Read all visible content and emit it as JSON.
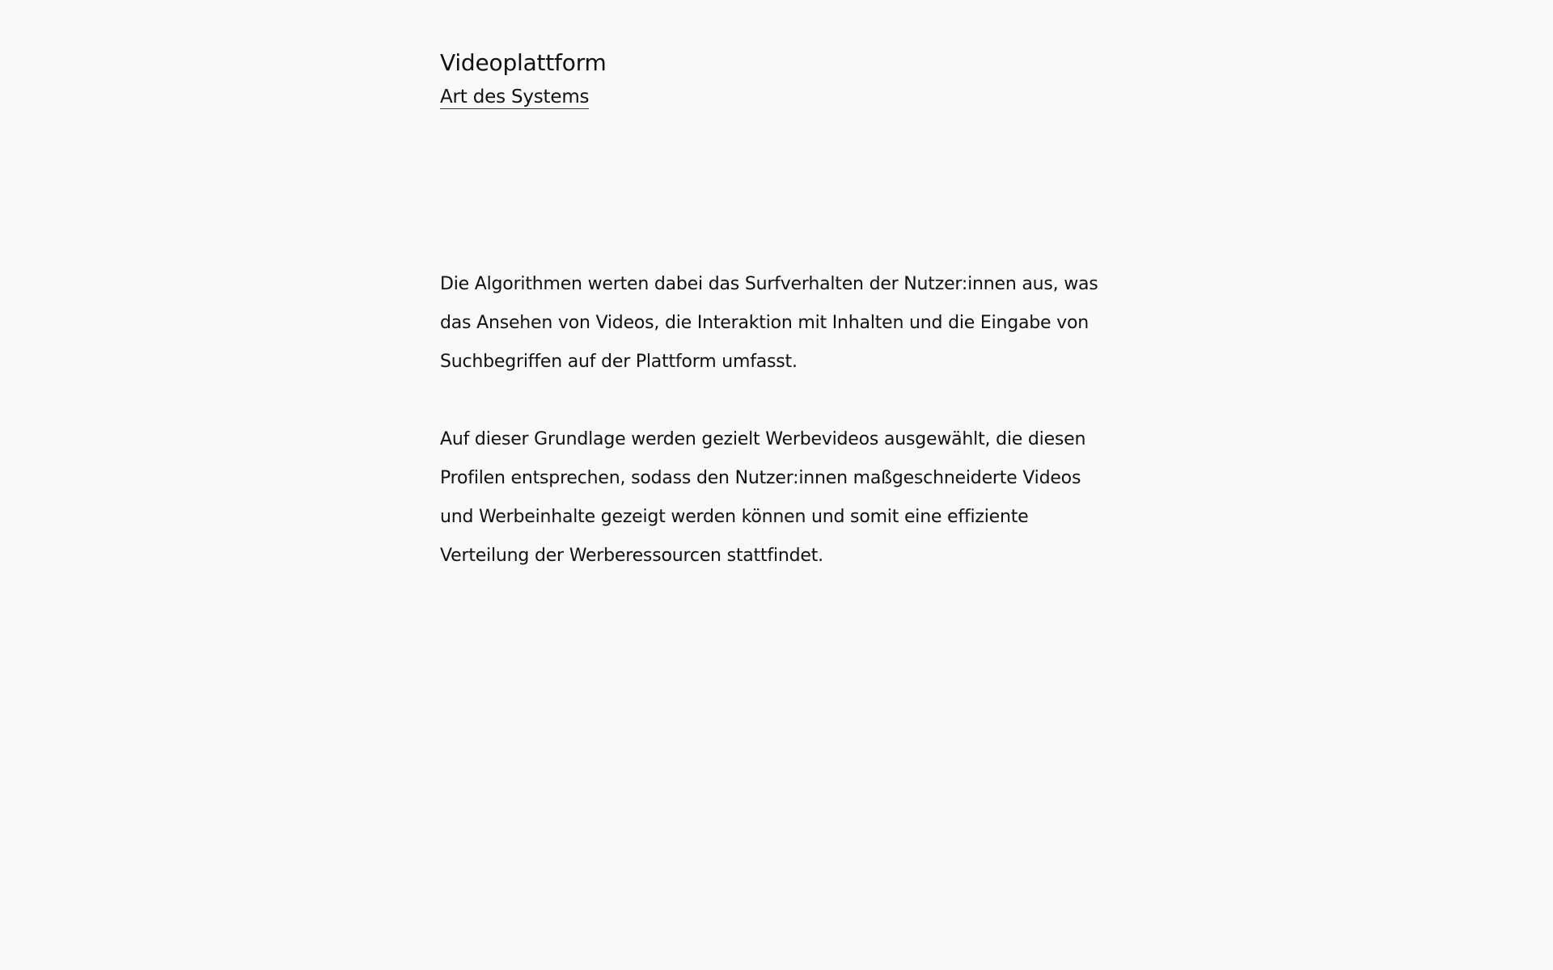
{
  "header": {
    "title": "Videoplattform",
    "section_link": "Art des Systems"
  },
  "content": {
    "paragraphs": [
      "Die Algorithmen werten dabei das Surfverhalten der Nutzer:innen aus, was das Ansehen von Videos, die Interaktion mit Inhalten und die Eingabe von Suchbegriffen auf der Plattform umfasst.",
      "Auf dieser Grundlage werden gezielt Werbevideos ausgewählt, die diesen Profilen entsprechen, sodass den Nutzer:innen maßgeschneiderte Videos und Werbeinhalte gezeigt werden können und somit eine effiziente Verteilung der Werberessourcen stattfindet."
    ]
  }
}
